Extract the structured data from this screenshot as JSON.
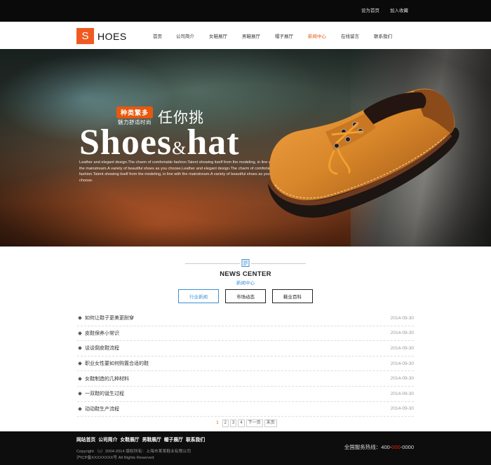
{
  "topbar": {
    "links": [
      "设为首页",
      "加入收藏"
    ]
  },
  "logo": {
    "letter": "S",
    "text": "HOES"
  },
  "nav": {
    "items": [
      {
        "label": "首页",
        "active": false
      },
      {
        "label": "公司简介",
        "active": false
      },
      {
        "label": "女鞋展厅",
        "active": false
      },
      {
        "label": "男鞋展厅",
        "active": false
      },
      {
        "label": "帽子展厅",
        "active": false
      },
      {
        "label": "新闻中心",
        "active": true
      },
      {
        "label": "在线留言",
        "active": false
      },
      {
        "label": "联系我们",
        "active": false
      }
    ]
  },
  "banner": {
    "badge": "种类繁多",
    "subtitle": "魅力舒适时尚",
    "headline": "任你挑",
    "brand_left": "Shoes",
    "brand_amp": "&",
    "brand_right": "hat",
    "description": "Leather and elegant design.The charm of comfortable fashion.Talent showing itself from the modeling, in line with the mainstream.A variety of beautiful shoes as you choose.Leather and elegant design.The charm of comfortable fashion.Talent showing itself from the modeling, in line with the mainstream.A variety of beautiful shoes as you choose."
  },
  "news": {
    "title": "NEWS CENTER",
    "subtitle": "新闻中心",
    "tabs": [
      {
        "label": "行业新闻",
        "active": true
      },
      {
        "label": "市场动态",
        "active": false
      },
      {
        "label": "鞋业百科",
        "active": false
      }
    ],
    "items": [
      {
        "title": "如何让鞋子更美更耐穿",
        "date": "2014-09-30"
      },
      {
        "title": "皮鞋保养小常识",
        "date": "2014-09-30"
      },
      {
        "title": "谈谈倒皮鞋流程",
        "date": "2014-09-30"
      },
      {
        "title": "职业女性要如何购置合适的鞋",
        "date": "2014-09-30"
      },
      {
        "title": "女鞋制造的几种材料",
        "date": "2014-09-30"
      },
      {
        "title": "一双鞋的诞生过程",
        "date": "2014-09-30"
      },
      {
        "title": "动动鞋生产流程",
        "date": "2014-09-30"
      }
    ],
    "pager": {
      "pages": [
        "1",
        "2",
        "3",
        "4"
      ],
      "next": "下一页",
      "last": "末页"
    }
  },
  "footer": {
    "links": [
      "网站首页",
      "公司简介",
      "女鞋展厅",
      "男鞋展厅",
      "帽子展厅",
      "联系我们"
    ],
    "copyright": "Copyright （c）2004-2014 版权所有：上海市某某鞋业有限公司",
    "icp": "沪ICP备XXXXXXXX号 All Rights Reserved",
    "hotline_label": "全国服务热线：",
    "hotline_a": "400-",
    "hotline_b": "000",
    "hotline_c": "-0000"
  },
  "colors": {
    "accent": "#e8580d",
    "link_blue": "#3b8fd6",
    "dark": "#0a0a0a"
  }
}
